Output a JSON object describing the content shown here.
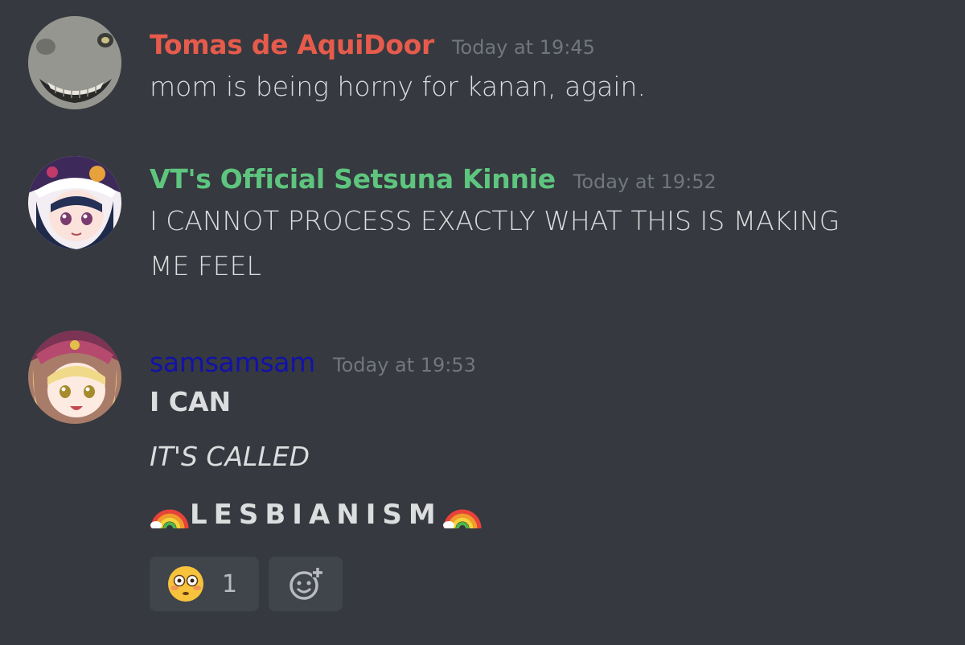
{
  "messages": [
    {
      "username": "Tomas de AquiDoor",
      "username_color": "#e65b4c",
      "timestamp": "Today at 19:45",
      "lines": [
        "mom is being horny for kanan, again."
      ]
    },
    {
      "username": "VT's Official Setsuna Kinnie",
      "username_color": "#5ec57f",
      "timestamp": "Today at 19:52",
      "lines": [
        "I CANNOT PROCESS EXACTLY WHAT THIS IS MAKING",
        "ME FEEL"
      ]
    },
    {
      "username": "samsamsam",
      "username_color": "#1112a8",
      "timestamp": "Today at 19:53",
      "lines": [
        "I CAN",
        "IT'S CALLED",
        "LESBIANISM"
      ]
    }
  ],
  "reactions": [
    {
      "emoji": "flushed-face-emoji",
      "count": "1"
    },
    {
      "emoji": "add-reaction-icon"
    }
  ]
}
